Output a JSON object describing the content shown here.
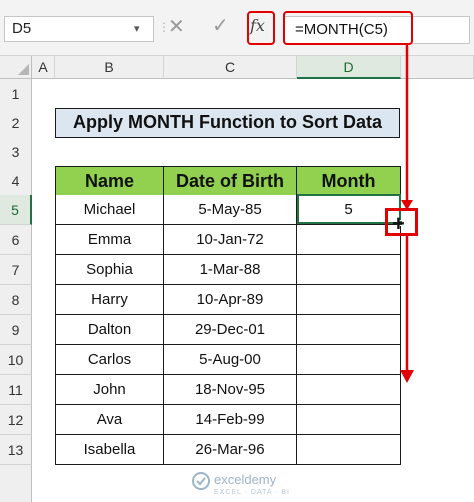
{
  "formula_bar": {
    "name_box": "D5",
    "formula": "=MONTH(C5)",
    "fx_label": "fx",
    "cancel_glyph": "✕",
    "enter_glyph": "✓"
  },
  "columns": [
    "A",
    "B",
    "C",
    "D"
  ],
  "rows": [
    "1",
    "2",
    "3",
    "4",
    "5",
    "6",
    "7",
    "8",
    "9",
    "10",
    "11",
    "12",
    "13"
  ],
  "sheet": {
    "title": "Apply MONTH Function to Sort Data",
    "headers": [
      "Name",
      "Date of Birth",
      "Month"
    ],
    "records": [
      {
        "name": "Michael",
        "dob": "5-May-85",
        "month": "5"
      },
      {
        "name": "Emma",
        "dob": "10-Jan-72",
        "month": ""
      },
      {
        "name": "Sophia",
        "dob": "1-Mar-88",
        "month": ""
      },
      {
        "name": "Harry",
        "dob": "10-Apr-89",
        "month": ""
      },
      {
        "name": "Dalton",
        "dob": "29-Dec-01",
        "month": ""
      },
      {
        "name": "Carlos",
        "dob": "5-Aug-00",
        "month": ""
      },
      {
        "name": "John",
        "dob": "18-Nov-95",
        "month": ""
      },
      {
        "name": "Ava",
        "dob": "14-Feb-99",
        "month": ""
      },
      {
        "name": "Isabella",
        "dob": "26-Mar-96",
        "month": ""
      }
    ]
  },
  "watermark": {
    "brand": "exceldemy",
    "tagline": "EXCEL · DATA · BI"
  },
  "colors": {
    "header_green": "#92d050",
    "title_fill": "#dce6f1",
    "annotation_red": "#e30000",
    "selection_green": "#217346"
  },
  "icons": [
    "cancel-icon",
    "enter-icon",
    "fx-icon",
    "fill-cursor-icon",
    "dropdown-arrow-icon"
  ]
}
